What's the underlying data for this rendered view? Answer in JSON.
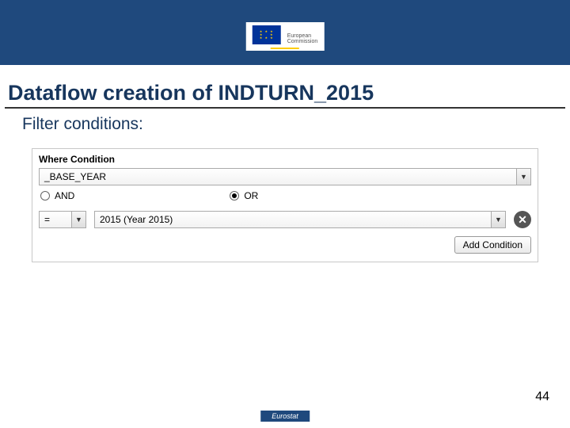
{
  "header": {
    "logo_top": "European",
    "logo_bottom": "Commission"
  },
  "title": "Dataflow creation of INDTURN_2015",
  "subtitle": "Filter conditions:",
  "condition": {
    "label": "Where Condition",
    "field": "_BASE_YEAR",
    "logic": {
      "and_label": "AND",
      "or_label": "OR",
      "selected": "OR"
    },
    "operator": "=",
    "value": "2015 (Year 2015)",
    "add_label": "Add Condition"
  },
  "footer": {
    "page": "44",
    "badge": "Eurostat"
  }
}
